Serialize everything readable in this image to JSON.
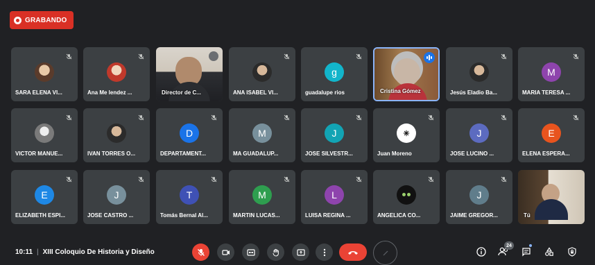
{
  "recording": {
    "label": "GRABANDO"
  },
  "tiles": [
    {
      "name": "SARA ELENA VI...",
      "avatar_type": "photo",
      "avatar_letter": "",
      "color": ""
    },
    {
      "name": "Ana Me lendez ...",
      "avatar_type": "photo2",
      "avatar_letter": "",
      "color": ""
    },
    {
      "name": "Director de C...",
      "avatar_type": "video1",
      "avatar_letter": "",
      "color": ""
    },
    {
      "name": "ANA ISABEL VI...",
      "avatar_type": "photo3",
      "avatar_letter": "",
      "color": ""
    },
    {
      "name": "guadalupe rios",
      "avatar_type": "letter",
      "avatar_letter": "g",
      "color": "#12b5cb"
    },
    {
      "name": "Cristina Gómez",
      "avatar_type": "video2",
      "avatar_letter": "",
      "color": "",
      "active": true
    },
    {
      "name": "Jesús Eladio Ba...",
      "avatar_type": "photo3",
      "avatar_letter": "",
      "color": ""
    },
    {
      "name": "MARIA TERESA ...",
      "avatar_type": "letter",
      "avatar_letter": "M",
      "color": "#8e44ad"
    },
    {
      "name": "VICTOR MANUE...",
      "avatar_type": "photo4",
      "avatar_letter": "",
      "color": ""
    },
    {
      "name": "IVAN TORRES O...",
      "avatar_type": "photo3",
      "avatar_letter": "",
      "color": ""
    },
    {
      "name": "DEPARTAMENT...",
      "avatar_type": "letter",
      "avatar_letter": "D",
      "color": "#1a73e8"
    },
    {
      "name": "MA GUADALUP...",
      "avatar_type": "letter",
      "avatar_letter": "M",
      "color": "#78909c"
    },
    {
      "name": "JOSE SILVESTR...",
      "avatar_type": "letter",
      "avatar_letter": "J",
      "color": "#12a4b4"
    },
    {
      "name": "Juan Moreno",
      "avatar_type": "logo",
      "avatar_letter": "✳",
      "color": ""
    },
    {
      "name": "JOSE LUCINO ...",
      "avatar_type": "letter",
      "avatar_letter": "J",
      "color": "#5c6bc0"
    },
    {
      "name": "ELENA ESPERA...",
      "avatar_type": "letter",
      "avatar_letter": "E",
      "color": "#e8541e"
    },
    {
      "name": "ELIZABETH ESPI...",
      "avatar_type": "letter",
      "avatar_letter": "E",
      "color": "#1e88e5"
    },
    {
      "name": "JOSE CASTRO ...",
      "avatar_type": "letter",
      "avatar_letter": "J",
      "color": "#78909c"
    },
    {
      "name": "Tomás Bernal Al...",
      "avatar_type": "letter",
      "avatar_letter": "T",
      "color": "#3f51b5"
    },
    {
      "name": "MARTIN LUCAS...",
      "avatar_type": "letter",
      "avatar_letter": "M",
      "color": "#2e9e4f"
    },
    {
      "name": "LUISA REGINA ...",
      "avatar_type": "letter",
      "avatar_letter": "L",
      "color": "#8e44ad"
    },
    {
      "name": "ANGELICA CO...",
      "avatar_type": "cat",
      "avatar_letter": "",
      "color": ""
    },
    {
      "name": "JAIME GREGOR...",
      "avatar_type": "letter",
      "avatar_letter": "J",
      "color": "#607d8b"
    },
    {
      "name": "Tú",
      "avatar_type": "video3",
      "avatar_letter": "",
      "color": ""
    }
  ],
  "bottom_bar": {
    "time": "10:11",
    "separator": "|",
    "meeting_title": "XIII Coloquio De Historia y Diseño",
    "participants_count": "24"
  },
  "colors": {
    "background": "#202124",
    "tile": "#3c4043",
    "danger": "#ea4335",
    "accent": "#8ab4f8"
  }
}
